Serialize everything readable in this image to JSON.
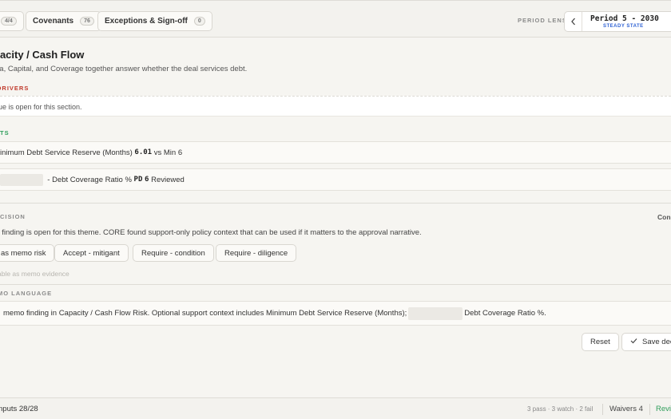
{
  "tabs": {
    "partial_count": "4/4",
    "covenants": {
      "label": "Covenants",
      "count": "76"
    },
    "exceptions": {
      "label": "Exceptions & Sign-off",
      "count": "0"
    }
  },
  "period_lens": {
    "label": "PERIOD LENS",
    "period": "Period 5 - 2030",
    "state": "STEADY STATE",
    "prev_icon": "chevron-left-icon"
  },
  "section": {
    "title": "pacity / Cash Flow",
    "subtitle": "na, Capital, and Coverage together answer whether the deal services debt."
  },
  "drivers": {
    "label": "DRIVERS",
    "text": "ue is open for this section."
  },
  "points": {
    "label": "TS",
    "row1": {
      "text": "inimum Debt Service Reserve (Months)",
      "value": "6.01",
      "suffix": "vs Min 6"
    },
    "row2": {
      "text": "- Debt Coverage Ratio %",
      "code": "PD",
      "code_value": "6",
      "suffix": "Reviewed"
    }
  },
  "decision": {
    "label": "ECISION",
    "right_label": "Con",
    "text": "t finding is open for this theme. CORE found support-only policy context that can be used if it matters to the approval narrative.",
    "options": [
      "as memo risk",
      "Accept - mitigant",
      "Require - condition",
      "Require - diligence"
    ],
    "evidence_hint": "able as memo evidence"
  },
  "memo": {
    "label": "MO LANGUAGE",
    "text_before": "memo finding in Capacity / Cash Flow Risk. Optional support context includes Minimum Debt Service Reserve (Months);",
    "text_after": "Debt Coverage Ratio %."
  },
  "actions": {
    "reset": "Reset",
    "save": "Save dec",
    "save_icon": "check-icon"
  },
  "footer": {
    "inputs": "nputs 28/28",
    "summary": "3 pass · 3 watch · 2 fail",
    "waivers": "Waivers 4",
    "review": "Revi"
  },
  "colors": {
    "drivers_accent": "#c0392b",
    "points_accent": "#2f9e5b",
    "state_accent": "#2f62d4"
  }
}
